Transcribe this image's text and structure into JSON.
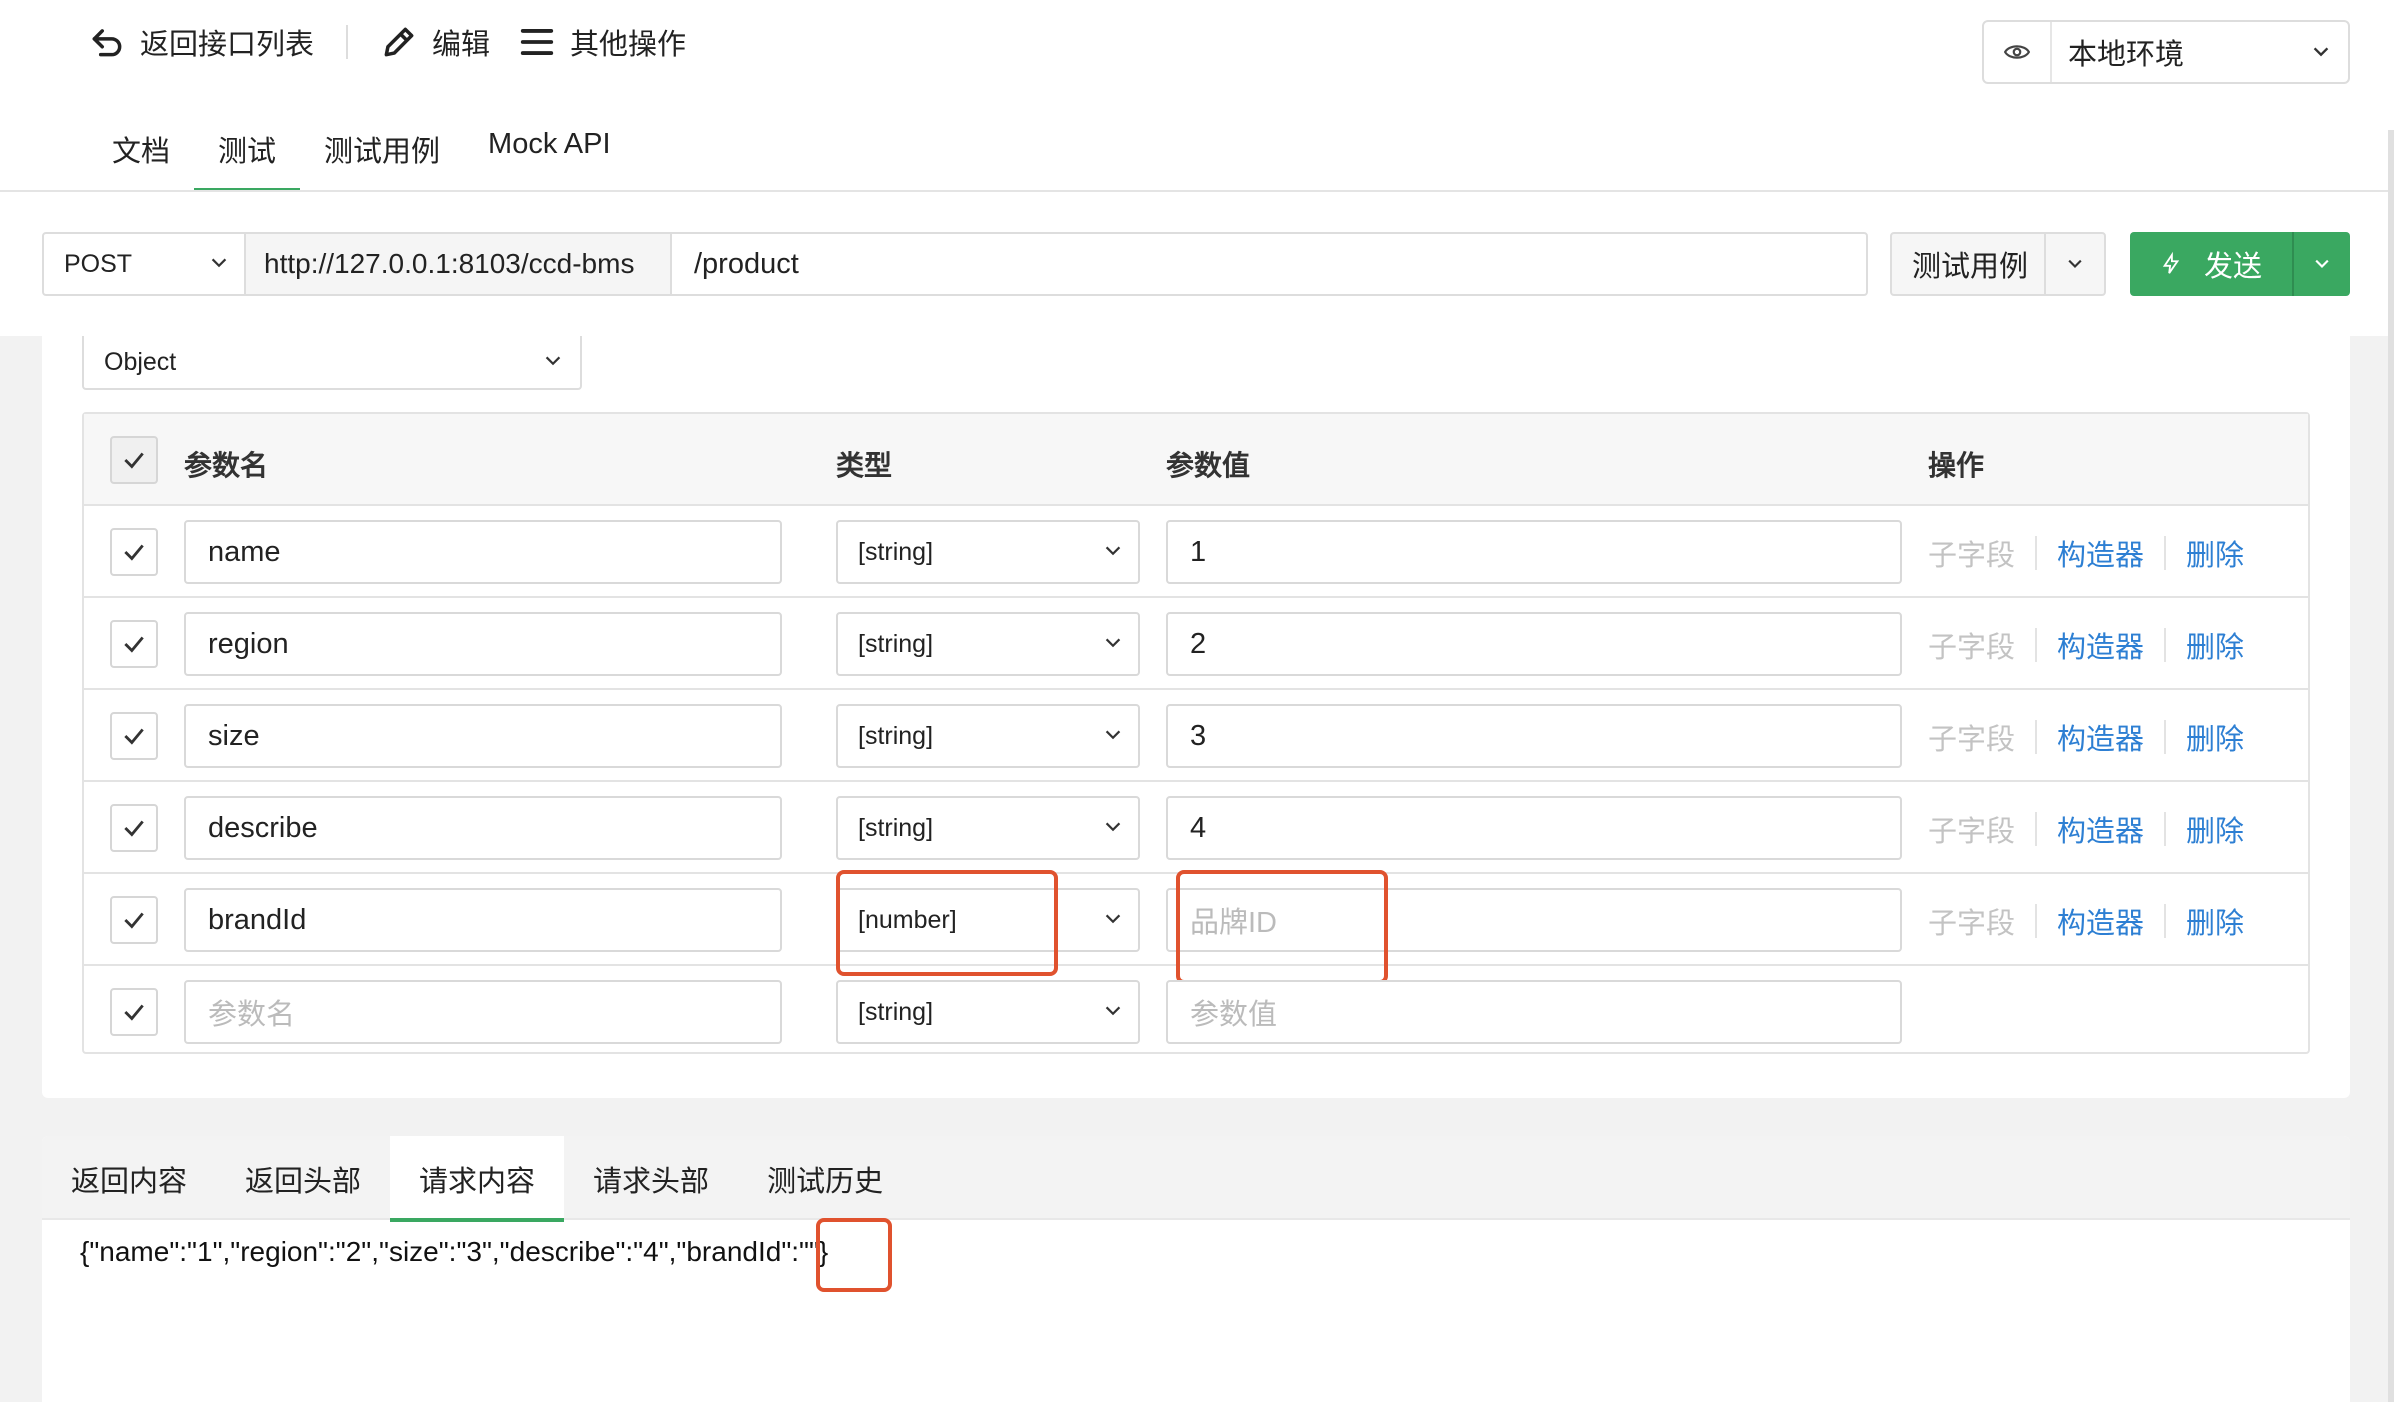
{
  "toolbar": {
    "back_label": "返回接口列表",
    "edit_label": "编辑",
    "more_label": "其他操作"
  },
  "env": {
    "selected": "本地环境"
  },
  "tabs": [
    {
      "label": "文档"
    },
    {
      "label": "测试",
      "active": true
    },
    {
      "label": "测试用例"
    },
    {
      "label": "Mock API"
    }
  ],
  "request": {
    "method": "POST",
    "base_url": "http://127.0.0.1:8103/ccd-bms",
    "path": "/product",
    "case_button": "测试用例",
    "send_button": "发送"
  },
  "body_type": "Object",
  "params_table": {
    "headers": {
      "name": "参数名",
      "type": "类型",
      "value": "参数值",
      "ops": "操作"
    },
    "rows": [
      {
        "name": "name",
        "type": "[string]",
        "value": "1"
      },
      {
        "name": "region",
        "type": "[string]",
        "value": "2"
      },
      {
        "name": "size",
        "type": "[string]",
        "value": "3"
      },
      {
        "name": "describe",
        "type": "[string]",
        "value": "4"
      },
      {
        "name": "brandId",
        "type": "[number]",
        "value_placeholder": "品牌ID"
      }
    ],
    "new_row": {
      "name_placeholder": "参数名",
      "type": "[string]",
      "value_placeholder": "参数值"
    },
    "ops": {
      "subfield": "子字段",
      "builder": "构造器",
      "delete": "删除"
    }
  },
  "response_tabs": [
    {
      "label": "返回内容"
    },
    {
      "label": "返回头部"
    },
    {
      "label": "请求内容",
      "active": true
    },
    {
      "label": "请求头部"
    },
    {
      "label": "测试历史"
    }
  ],
  "request_body": "{\"name\":\"1\",\"region\":\"2\",\"size\":\"3\",\"describe\":\"4\",\"brandId\":\"\"}",
  "colors": {
    "accent": "#3aa861",
    "link": "#2d7fd3",
    "highlight": "#e0522e"
  }
}
